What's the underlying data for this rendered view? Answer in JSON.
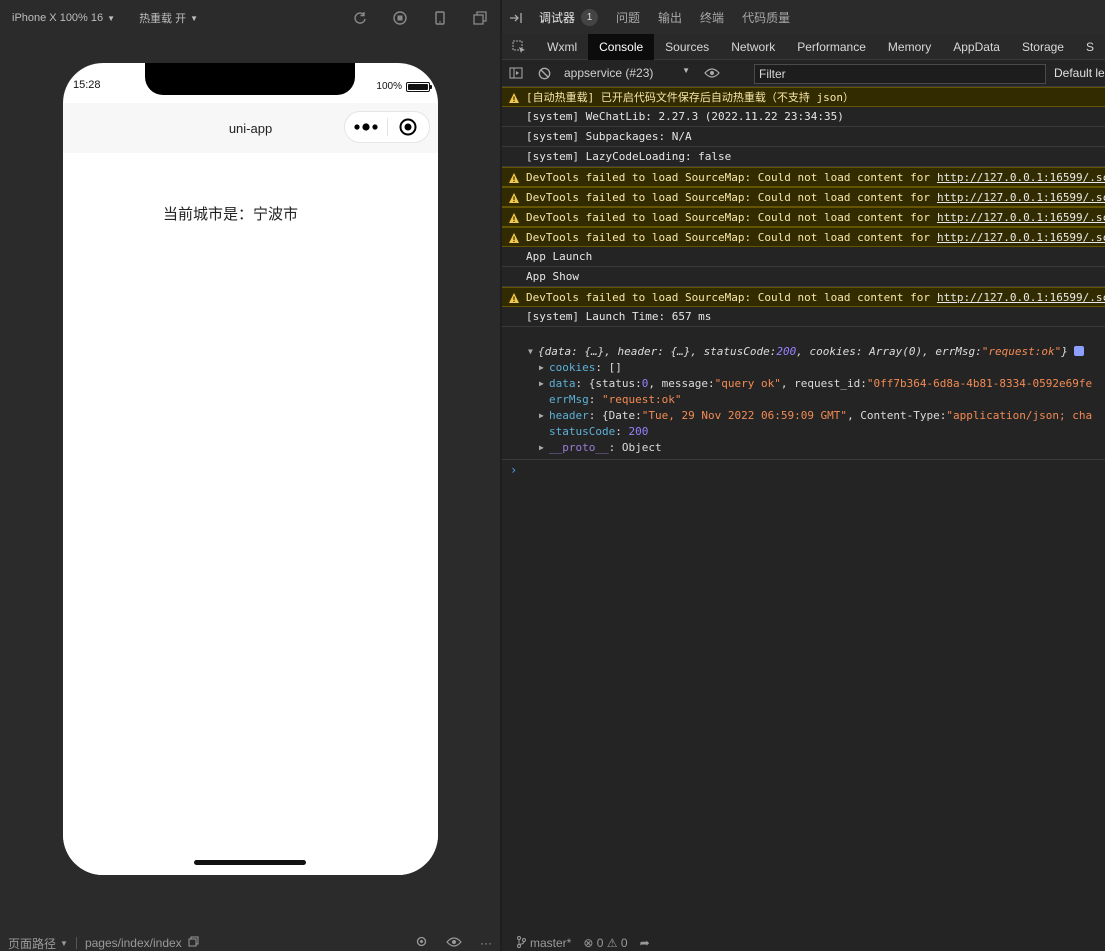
{
  "simulator": {
    "device_label": "iPhone X 100% 16",
    "hotreload_label": "热重载 开",
    "status_time": "15:28",
    "battery_text": "100%",
    "battery_level": 1.0,
    "nav_title": "uni-app",
    "page_text": "当前城市是：宁波市",
    "footer_path_label": "页面路径",
    "footer_path": "pages/index/index"
  },
  "devtools": {
    "top_tabs": [
      "调试器",
      "问题",
      "输出",
      "终端",
      "代码质量"
    ],
    "debugger_badge": "1",
    "panel_tabs": [
      "Wxml",
      "Console",
      "Sources",
      "Network",
      "Performance",
      "Memory",
      "AppData",
      "Storage",
      "S"
    ],
    "active_panel": "Console",
    "context": "appservice (#23)",
    "filter_placeholder": "Filter",
    "levels_label": "Default le",
    "console_lines": [
      {
        "type": "warn",
        "text": "[自动热重载] 已开启代码文件保存后自动热重载（不支持 json）",
        "link": ""
      },
      {
        "type": "log",
        "text": "[system] WeChatLib: 2.27.3 (2022.11.22 23:34:35)",
        "link": ""
      },
      {
        "type": "log",
        "text": "[system] Subpackages: N/A",
        "link": ""
      },
      {
        "type": "log",
        "text": "[system] LazyCodeLoading: false",
        "link": ""
      },
      {
        "type": "warn",
        "text": "DevTools failed to load SourceMap: Could not load content for",
        "link": "http://127.0.0.1:16599/.sc"
      },
      {
        "type": "warn",
        "text": "DevTools failed to load SourceMap: Could not load content for",
        "link": "http://127.0.0.1:16599/.sc"
      },
      {
        "type": "warn",
        "text": "DevTools failed to load SourceMap: Could not load content for",
        "link": "http://127.0.0.1:16599/.sc"
      },
      {
        "type": "warn",
        "text": "DevTools failed to load SourceMap: Could not load content for",
        "link": "http://127.0.0.1:16599/.sc"
      },
      {
        "type": "log",
        "text": "App Launch",
        "link": ""
      },
      {
        "type": "log",
        "text": "App Show",
        "link": ""
      },
      {
        "type": "warn",
        "text": "DevTools failed to load SourceMap: Could not load content for",
        "link": "http://127.0.0.1:16599/.sc"
      },
      {
        "type": "log",
        "text": "[system] Launch Time: 657 ms",
        "link": ""
      }
    ],
    "object_summary": {
      "p1": "{data: {…}, header: {…}, statusCode: ",
      "status": "200",
      "p2": ", cookies: Array(0), errMsg: ",
      "errmsg": "\"request:ok\"",
      "p3": "}"
    },
    "object_props": {
      "cookies_key": "cookies",
      "cookies_val": "[]",
      "data_key": "data",
      "data_p1": "{status: ",
      "data_status": "0",
      "data_p2": ", message: ",
      "data_message": "\"query ok\"",
      "data_p3": ", request_id: ",
      "data_reqid": "\"0ff7b364-6d8a-4b81-8334-0592e69fe",
      "errmsg_key": "errMsg",
      "errmsg_val": "\"request:ok\"",
      "header_key": "header",
      "header_p1": "{Date: ",
      "header_date": "\"Tue, 29 Nov 2022 06:59:09 GMT\"",
      "header_p2": ", Content-Type: ",
      "header_ct": "\"application/json; cha",
      "status_key": "statusCode",
      "status_val": "200",
      "proto_key": "__proto__",
      "proto_val": "Object"
    },
    "prompt": "›",
    "footer_branch": "master*",
    "footer_errors": "0",
    "footer_warnings": "0"
  },
  "colors": {
    "warn_bg": "#332b00",
    "warn_text": "#f5e6a8",
    "key_blue": "#5db0d7",
    "string_orange": "#f28b54",
    "number_purple": "#9980ff"
  }
}
